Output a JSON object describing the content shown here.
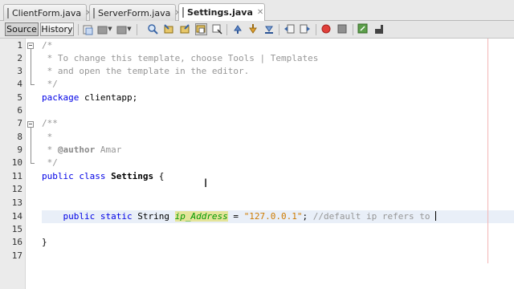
{
  "tabs": [
    {
      "label": "ClientForm.java",
      "active": false
    },
    {
      "label": "ServerForm.java",
      "active": false
    },
    {
      "label": "Settings.java",
      "active": true
    }
  ],
  "tab_close_glyph": "✕",
  "toolbar": {
    "source_label": "Source",
    "history_label": "History",
    "icons": [
      "last-edit-icon",
      "back-icon",
      "forward-icon",
      "find-icon",
      "find-previous-icon",
      "find-next-icon",
      "toggle-highlight-icon",
      "find-selection-icon",
      "toggle-bookmark-icon",
      "previous-bookmark-icon",
      "next-bookmark-icon",
      "shift-left-icon",
      "shift-right-icon",
      "start-macro-icon",
      "stop-macro-icon",
      "comment-icon",
      "uncomment-icon"
    ]
  },
  "editor": {
    "line_numbers": [
      "1",
      "2",
      "3",
      "4",
      "5",
      "6",
      "7",
      "8",
      "9",
      "10",
      "11",
      "12",
      "13",
      "14",
      "15",
      "16",
      "17"
    ],
    "lines": {
      "l1": "/*",
      "l2": " * To change this template, choose Tools | Templates",
      "l3": " * and open the template in the editor.",
      "l4": " */",
      "l5_kw": "package",
      "l5_rest": " clientapp;",
      "l7": "/**",
      "l8": " *",
      "l9_pre": " * ",
      "l9_tag": "@author",
      "l9_rest": " Amar",
      "l10": " */",
      "l11_kw": "public class",
      "l11_name": "Settings",
      "l11_rest": " {",
      "l14_indent": "    ",
      "l14_kw": "public static",
      "l14_type": " String ",
      "l14_field": "ip_Address",
      "l14_eq": " = ",
      "l14_str": "\"127.0.0.1\"",
      "l14_semi": "; ",
      "l14_comment": "//default ip refers to ",
      "l16": "}"
    }
  },
  "colors": {
    "keyword": "#0000e6",
    "comment": "#969696",
    "string": "#ce7b00",
    "field": "#009900",
    "field_highlight": "#e4e49a",
    "current_line": "#e9eff8"
  }
}
